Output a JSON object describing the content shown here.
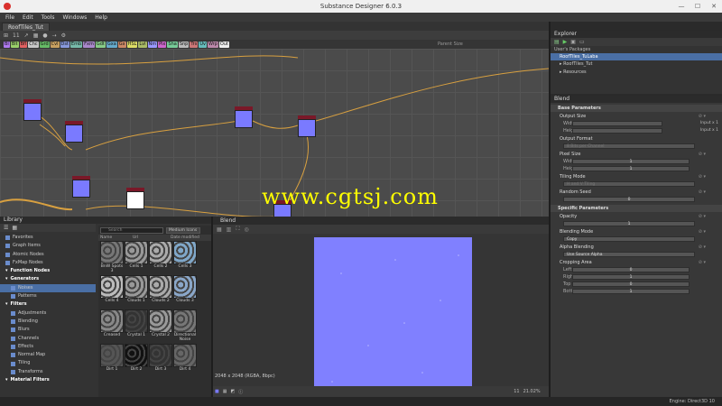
{
  "window": {
    "title": "Substance Designer 6.0.3",
    "min": "—",
    "max": "☐",
    "close": "✕"
  },
  "menu": [
    "File",
    "Edit",
    "Tools",
    "Windows",
    "Help"
  ],
  "graph": {
    "tab": "RoofTiles_Tut",
    "toolbar": [
      "⊞",
      "11",
      "↗",
      "▦",
      "●",
      "⇢",
      "⚙"
    ],
    "nodes": [
      "Bl",
      "Blt",
      "Bfl",
      "Chc",
      "Grd",
      "Cvl",
      "Dst",
      "Emb",
      "Fxm",
      "Gdt",
      "Gxa",
      "Gx",
      "HSL",
      "Lvl",
      "Nm",
      "Pix",
      "Sha",
      "Snp",
      "Trs",
      "Uv",
      "Wrp",
      "Out"
    ],
    "node_colors": [
      "#b07af0",
      "#9ad06a",
      "#e06060",
      "#c8c8c8",
      "#66bb66",
      "#c8a060",
      "#8899dd",
      "#77bbaa",
      "#aa88cc",
      "#88cc88",
      "#66aacc",
      "#cc8866",
      "#dddd66",
      "#aabb66",
      "#9999ff",
      "#cc66cc",
      "#77cc99",
      "#bbbbbb",
      "#cc7777",
      "#66bbbb",
      "#bb88aa",
      "#eeeeee"
    ],
    "parent_size_label": "Parent Size"
  },
  "explorer": {
    "title": "Explorer",
    "toolbar_icons": [
      "new-graph-icon",
      "play-icon",
      "save-icon",
      "folder-icon"
    ],
    "section": "User's Packages",
    "package": "RoofTiles_TuLaba",
    "items": [
      "RoofTiles_Tut",
      "Resources"
    ]
  },
  "properties": {
    "title": "Blend",
    "base_section": "Base Parameters",
    "output_size": {
      "label": "Output Size",
      "width_label": "Width",
      "height_label": "Height",
      "width_mode": "Input x 1",
      "height_mode": "Input x 1"
    },
    "output_format": {
      "label": "Output Format",
      "value": "8 Bits per Channel"
    },
    "pixel_size": {
      "label": "Pixel Size",
      "width_label": "Width",
      "height_label": "Height",
      "width_value": "1",
      "height_value": "1"
    },
    "tiling_mode": {
      "label": "Tiling Mode",
      "value": "H and V Tiling"
    },
    "random_seed": {
      "label": "Random Seed",
      "value": "0"
    },
    "specific_section": "Specific Parameters",
    "opacity": {
      "label": "Opacity",
      "value": "1"
    },
    "blending_mode": {
      "label": "Blending Mode",
      "value": "Copy"
    },
    "alpha_blending": {
      "label": "Alpha Blending",
      "value": "Use Source Alpha"
    },
    "cropping": {
      "label": "Cropping Area",
      "left_label": "Left",
      "right_label": "Right",
      "top_label": "Top",
      "bottom_label": "Bottom",
      "left": "0",
      "right": "1",
      "top": "0",
      "bottom": "1"
    }
  },
  "library": {
    "title": "Library",
    "tree": [
      {
        "label": "Favorites",
        "kind": "item"
      },
      {
        "label": "Graph Items",
        "kind": "item"
      },
      {
        "label": "Atomic Nodes",
        "kind": "item"
      },
      {
        "label": "FxMap Nodes",
        "kind": "item"
      },
      {
        "label": "Function Nodes",
        "kind": "cat"
      },
      {
        "label": "Generators",
        "kind": "cat"
      },
      {
        "label": "Noises",
        "kind": "sub",
        "selected": true
      },
      {
        "label": "Patterns",
        "kind": "sub"
      },
      {
        "label": "Filters",
        "kind": "cat"
      },
      {
        "label": "Adjustments",
        "kind": "sub"
      },
      {
        "label": "Blending",
        "kind": "sub"
      },
      {
        "label": "Blurs",
        "kind": "sub"
      },
      {
        "label": "Channels",
        "kind": "sub"
      },
      {
        "label": "Effects",
        "kind": "sub"
      },
      {
        "label": "Normal Map",
        "kind": "sub"
      },
      {
        "label": "Tiling",
        "kind": "sub"
      },
      {
        "label": "Transforms",
        "kind": "sub"
      },
      {
        "label": "Material Filters",
        "kind": "cat"
      }
    ],
    "search_placeholder": "Search",
    "thumb_size": "Medium Icons",
    "columns": [
      "Name",
      "Url",
      "Date modified"
    ],
    "thumbs": [
      {
        "label": "BnW Spots 3",
        "tone": "#777"
      },
      {
        "label": "Cells 1",
        "tone": "#999"
      },
      {
        "label": "Cells 2",
        "tone": "#aaa"
      },
      {
        "label": "Cells 3",
        "tone": "#7fa7c9"
      },
      {
        "label": "Cells 4",
        "tone": "#bbb"
      },
      {
        "label": "Clouds 1",
        "tone": "#999"
      },
      {
        "label": "Clouds 2",
        "tone": "#aaa"
      },
      {
        "label": "Clouds 3",
        "tone": "#8aa7c9"
      },
      {
        "label": "Creased",
        "tone": "#888"
      },
      {
        "label": "Crystal 1",
        "tone": "#333"
      },
      {
        "label": "Crystal 2",
        "tone": "#999"
      },
      {
        "label": "Directional Noise",
        "tone": "#777"
      },
      {
        "label": "Dirt 1",
        "tone": "#555"
      },
      {
        "label": "Dirt 2",
        "tone": "#111"
      },
      {
        "label": "Dirt 3",
        "tone": "#333"
      },
      {
        "label": "Dirt 4",
        "tone": "#666"
      }
    ]
  },
  "viewer": {
    "title": "Blend",
    "info": "2048 x 2048 (RGBA, 8bpc)",
    "zoom": "21.02%",
    "page": "11"
  },
  "status": {
    "engine": "Engine: Direct3D 10"
  },
  "watermark": "www.cgtsj.com"
}
